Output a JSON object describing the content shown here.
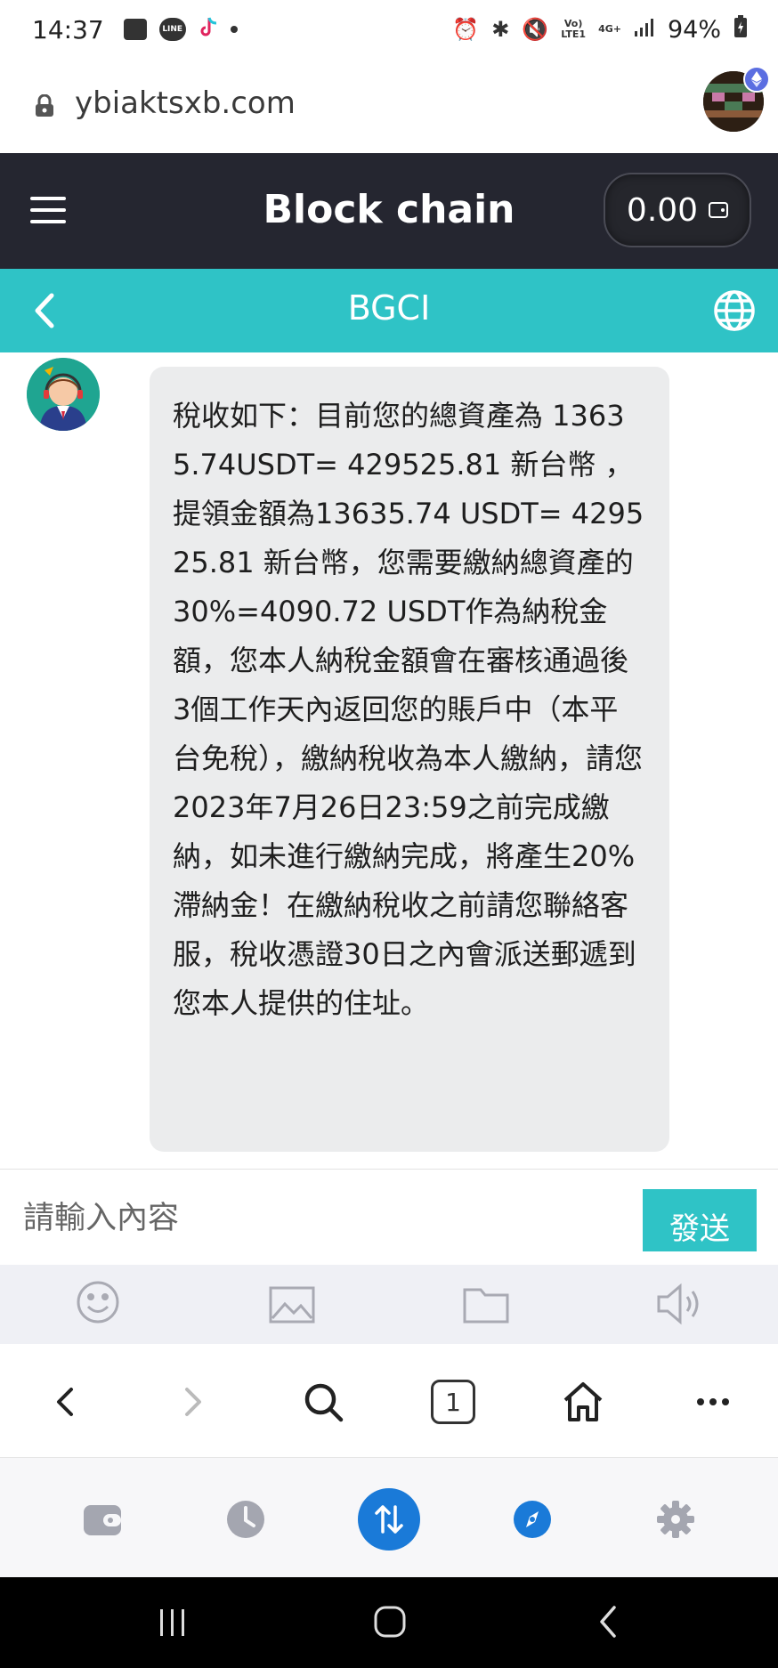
{
  "status_bar": {
    "time": "14:37",
    "line_label": "LINE",
    "network_top": "Vo)",
    "network_bottom": "LTE1",
    "network_type": "4G+",
    "battery": "94%"
  },
  "browser": {
    "url": "ybiaktsxb.com"
  },
  "app_header": {
    "title": "Block chain",
    "balance": "0.00"
  },
  "chat_header": {
    "title": "BGCI"
  },
  "messages": [
    {
      "sender": "agent",
      "text": "稅收如下：目前您的總資產為 13635.74USDT= 429525.81 新台幣 ，提領金額為13635.74 USDT= 429525.81 新台幣，您需要繳納總資產的30%=4090.72 USDT作為納稅金額，您本人納稅金額會在審核通過後3個工作天內返回您的賬戶中（本平台免稅），繳納稅收為本人繳納，請您2023年7月26日23:59之前完成繳納，如未進行繳納完成，將產生20%滯納金！在繳納稅收之前請您聯絡客服，稅收憑證30日之內會派送郵遞到您本人提供的住址。"
    }
  ],
  "composer": {
    "placeholder": "請輸入內容",
    "send_label": "發送"
  },
  "tools": [
    "emoji-icon",
    "image-icon",
    "folder-icon",
    "speaker-icon"
  ],
  "browser_nav": {
    "tab_count": "1"
  },
  "bottom_bar": [
    "wallet-icon",
    "history-icon",
    "transfer-icon",
    "discover-icon",
    "settings-icon"
  ],
  "colors": {
    "teal": "#2fc3c6",
    "header_dark": "#252630",
    "bubble": "#ebeced",
    "accent_blue": "#1a7ad8"
  }
}
